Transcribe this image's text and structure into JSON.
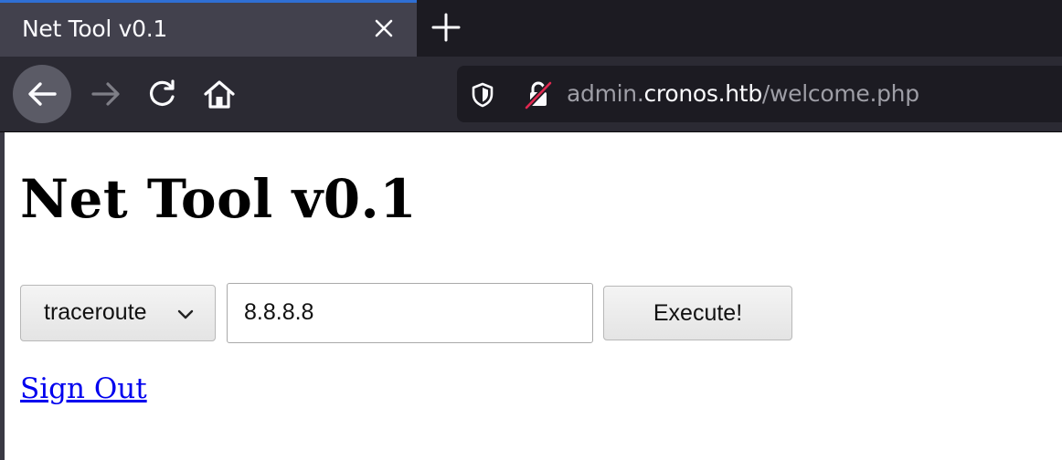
{
  "browser": {
    "tab": {
      "title": "Net Tool v0.1"
    },
    "url": {
      "prefix": "admin.",
      "host": "cronos.htb",
      "path": "/welcome.php"
    }
  },
  "page": {
    "title": "Net Tool v0.1",
    "form": {
      "command_select": {
        "selected": "traceroute"
      },
      "host_input": {
        "value": "8.8.8.8"
      },
      "execute_label": "Execute!"
    },
    "sign_out_link": "Sign Out"
  }
}
